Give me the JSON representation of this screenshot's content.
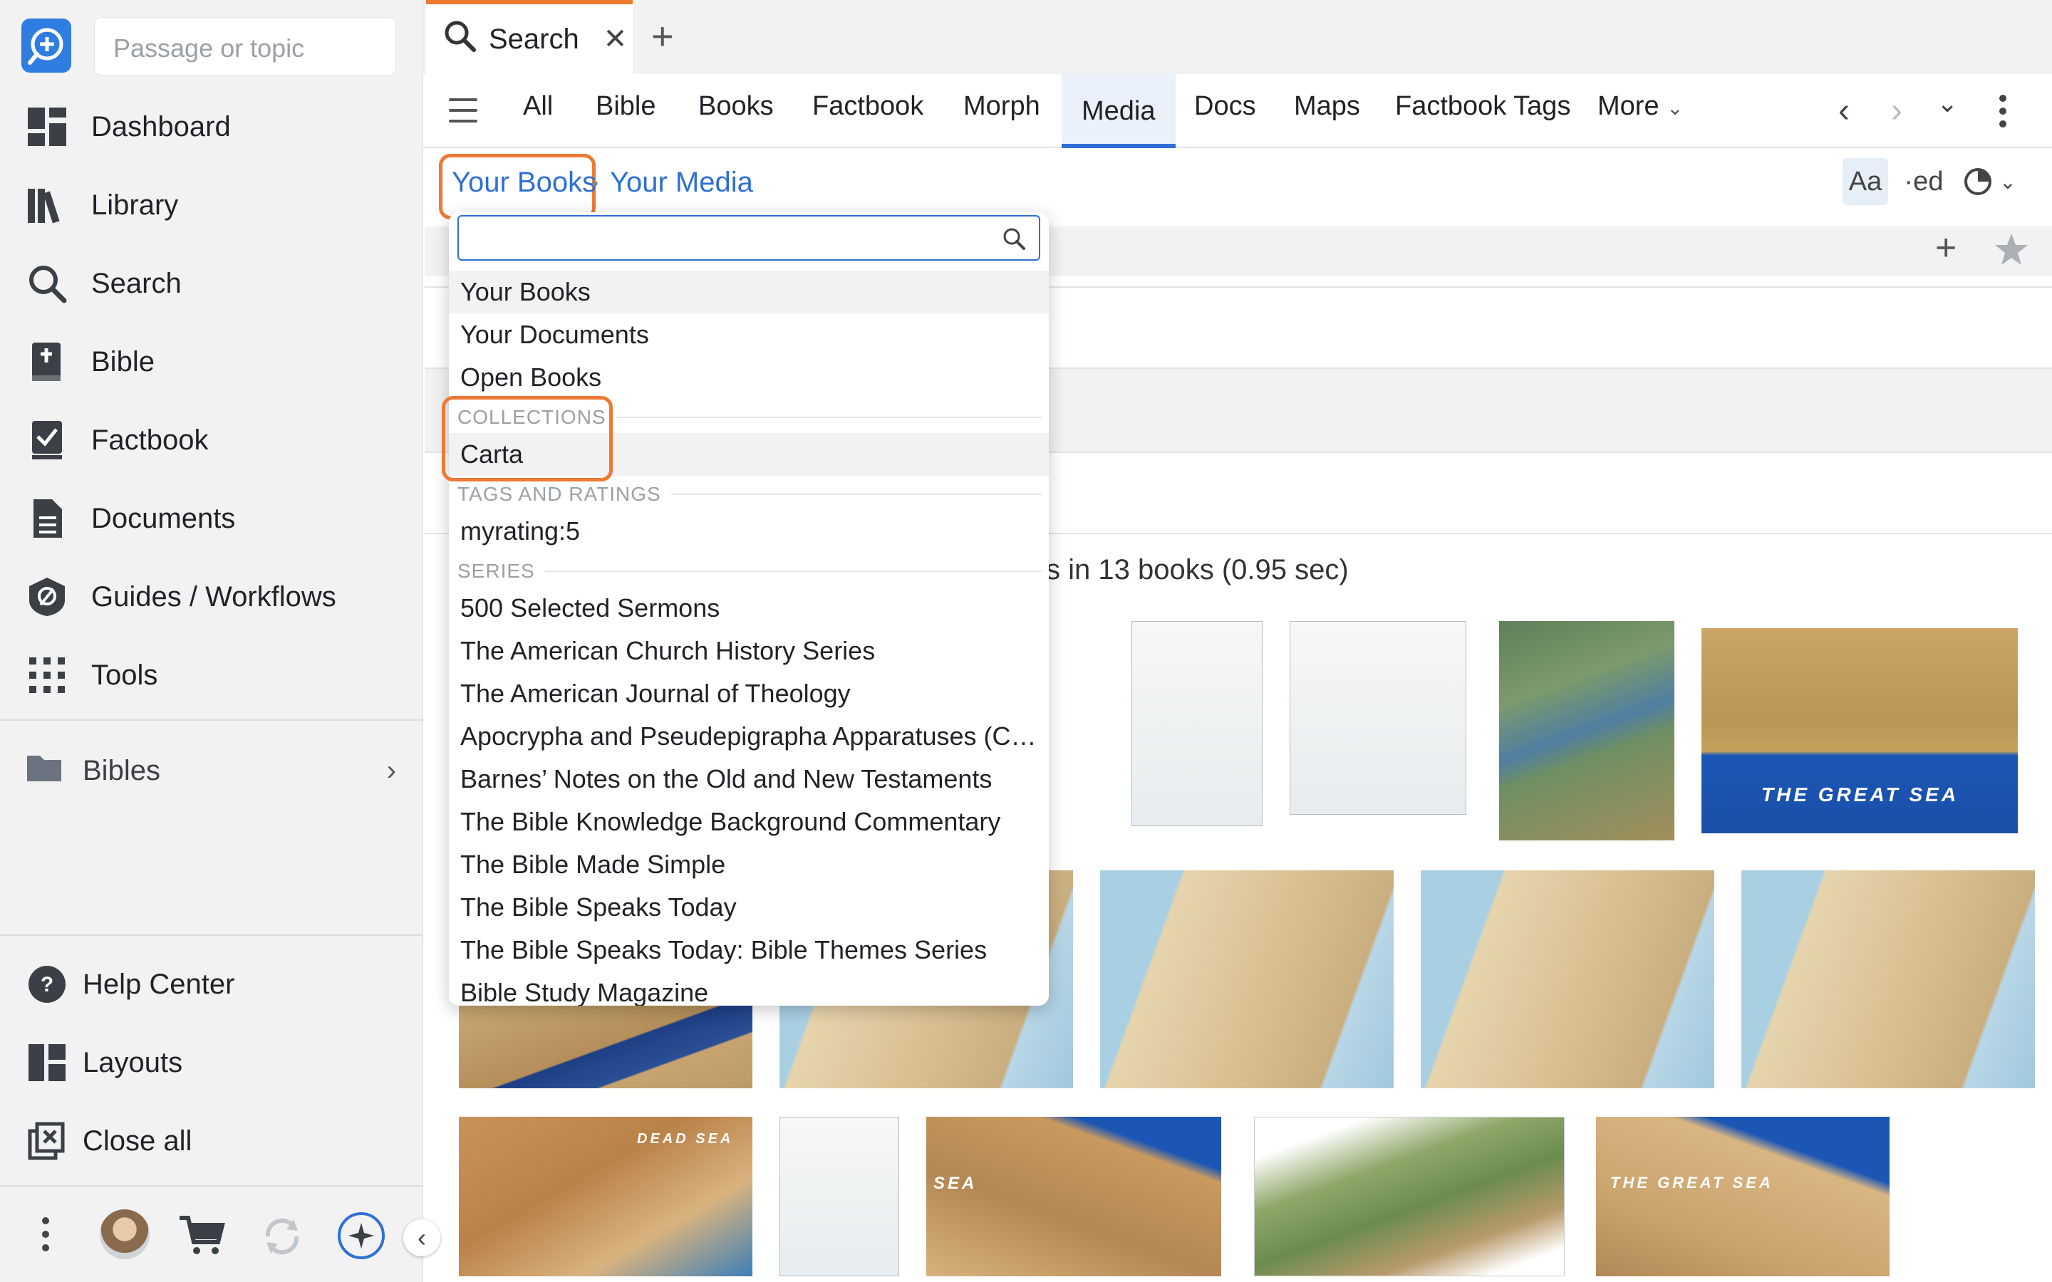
{
  "sidebar": {
    "passage_placeholder": "Passage or topic",
    "nav": [
      {
        "label": "Dashboard",
        "icon": "dashboard-icon"
      },
      {
        "label": "Library",
        "icon": "library-icon"
      },
      {
        "label": "Search",
        "icon": "search-icon"
      },
      {
        "label": "Bible",
        "icon": "bible-icon"
      },
      {
        "label": "Factbook",
        "icon": "factbook-icon"
      },
      {
        "label": "Documents",
        "icon": "documents-icon"
      },
      {
        "label": "Guides / Workflows",
        "icon": "guides-icon"
      },
      {
        "label": "Tools",
        "icon": "tools-icon"
      }
    ],
    "bibles_label": "Bibles",
    "bottom": [
      {
        "label": "Help Center",
        "icon": "help-icon"
      },
      {
        "label": "Layouts",
        "icon": "layouts-icon"
      },
      {
        "label": "Close all",
        "icon": "close-all-icon"
      }
    ]
  },
  "tabs": {
    "active_label": "Search"
  },
  "search_nav": {
    "tabs": [
      "All",
      "Bible",
      "Books",
      "Factbook",
      "Morph",
      "Media",
      "Docs",
      "Maps",
      "Factbook Tags"
    ],
    "active": "Media",
    "more_label": "More"
  },
  "breadcrumb": {
    "scope": "Your Books",
    "separator": "•",
    "current": "Your Media"
  },
  "toolbar": {
    "aa_label": "Aa",
    "ed_label": "·ed"
  },
  "results": {
    "text": "s in 13 books (0.95 sec)"
  },
  "dropdown": {
    "search_value": "",
    "items_top": [
      "Your Books",
      "Your Documents",
      "Open Books"
    ],
    "collections_header": "COLLECTIONS",
    "collections": [
      "Carta"
    ],
    "tags_header": "TAGS AND RATINGS",
    "tags": [
      "myrating:5"
    ],
    "series_header": "SERIES",
    "series": [
      "500 Selected Sermons",
      "The American Church History Series",
      "The American Journal of Theology",
      "Apocrypha and Pseudepigrapha Apparatuses (Cha…",
      "Barnes’ Notes on the Old and New Testaments",
      "The Bible Knowledge Background Commentary",
      "The Bible Made Simple",
      "The Bible Speaks Today",
      "The Bible Speaks Today: Bible Themes Series",
      "Bible Study Magazine"
    ]
  },
  "thumb_labels": {
    "great_sea": "THE GREAT SEA",
    "dead_sea": "DEAD SEA",
    "sea": "SEA"
  },
  "colors": {
    "accent_orange": "#ec7a35",
    "link_blue": "#2f6fd6",
    "logo_blue": "#2f7de1"
  }
}
